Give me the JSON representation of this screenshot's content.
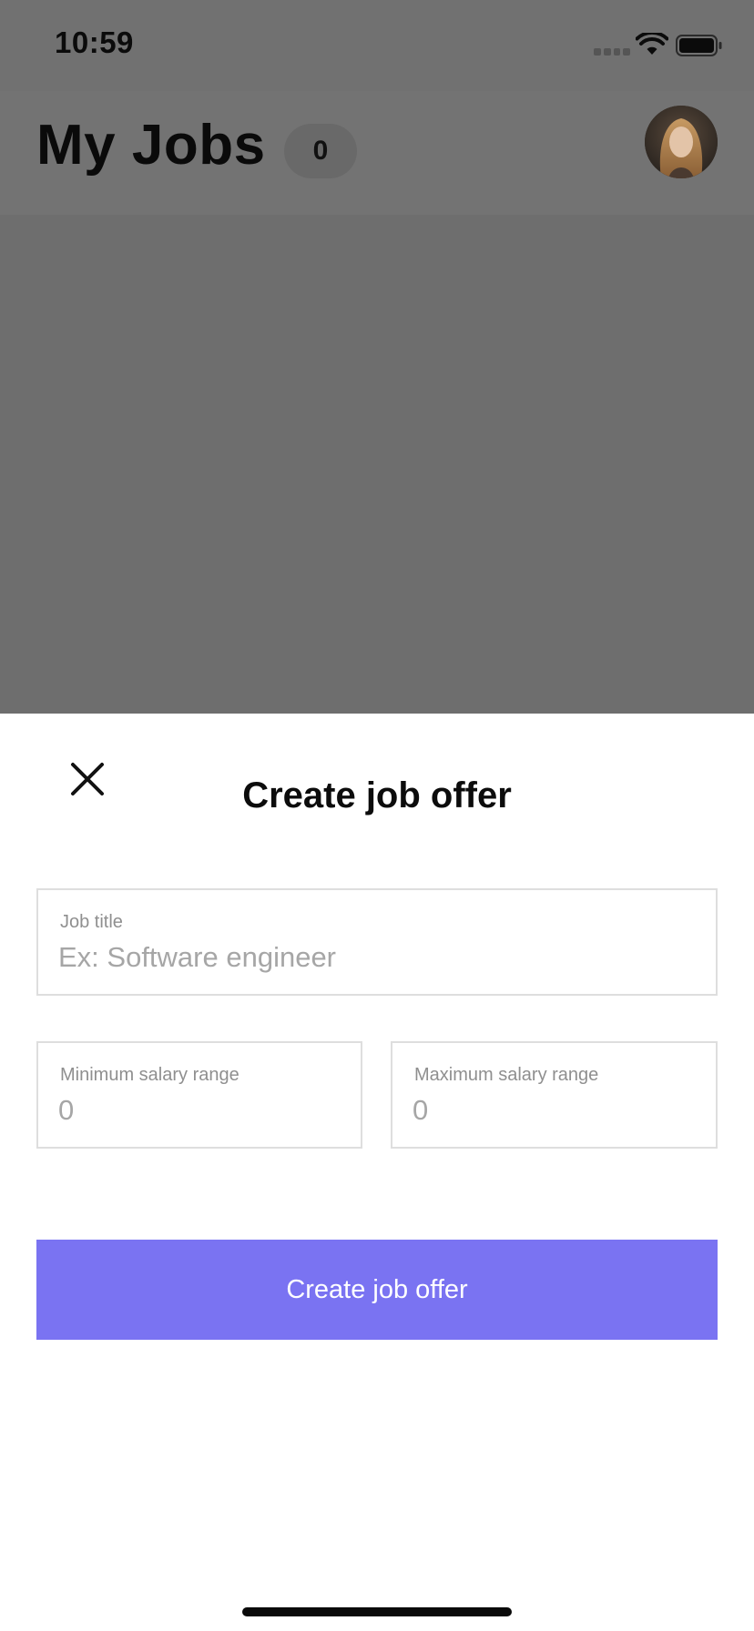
{
  "status_bar": {
    "time": "10:59"
  },
  "header": {
    "title": "My Jobs",
    "job_count": "0"
  },
  "sheet": {
    "title": "Create job offer",
    "fields": {
      "job_title": {
        "label": "Job title",
        "placeholder": "Ex: Software engineer",
        "value": ""
      },
      "min_salary": {
        "label": "Minimum salary range",
        "placeholder": "0",
        "value": ""
      },
      "max_salary": {
        "label": "Maximum salary range",
        "placeholder": "0",
        "value": ""
      }
    },
    "submit_label": "Create job offer"
  },
  "colors": {
    "accent": "#7a73f2",
    "overlay": "#6e6e6e",
    "field_border": "#dedede"
  },
  "icons": {
    "close": "close-icon",
    "wifi": "wifi-icon",
    "battery": "battery-icon",
    "signal": "cellular-signal-icon"
  }
}
